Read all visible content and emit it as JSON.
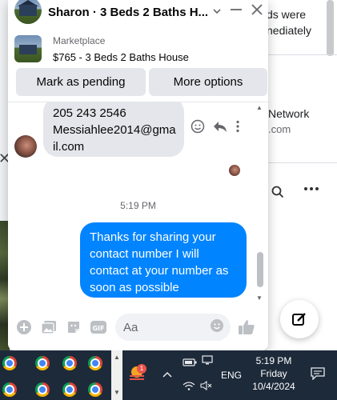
{
  "chat": {
    "title": "Sharon · 3 Beds 2 Baths H...",
    "marketplace_label": "Marketplace",
    "listing": "$765 - 3 Beds 2 Baths House",
    "buttons": {
      "mark_pending": "Mark as pending",
      "more_options": "More options"
    },
    "messages": {
      "incoming_lines": [
        "205 243 2546",
        "Messiahlee2014@gma",
        "il.com"
      ],
      "timestamp": "5:19 PM",
      "outgoing_lines": [
        "Thanks for sharing your",
        "contact number I will",
        "contact at your number as",
        "soon as possible"
      ]
    },
    "composer": {
      "placeholder": "Aa"
    }
  },
  "background": {
    "text1": "ds were",
    "text2": "nediately",
    "text3": "Network",
    "text4": ".com"
  },
  "taskbar": {
    "language": "ENG",
    "time": "5:19 PM",
    "day": "Friday",
    "date": "10/4/2024",
    "badge": "1"
  },
  "colors": {
    "accent": "#0084ff",
    "taskbar": "#1d2a3a"
  },
  "icons": [
    "minimize-icon",
    "close-icon",
    "chevron-down-icon",
    "emoji-icon",
    "reply-icon",
    "more-vertical-icon",
    "plus-icon",
    "image-icon",
    "sticker-icon",
    "gif-icon",
    "like-icon",
    "compose-icon",
    "search-icon",
    "chrome-icon"
  ]
}
